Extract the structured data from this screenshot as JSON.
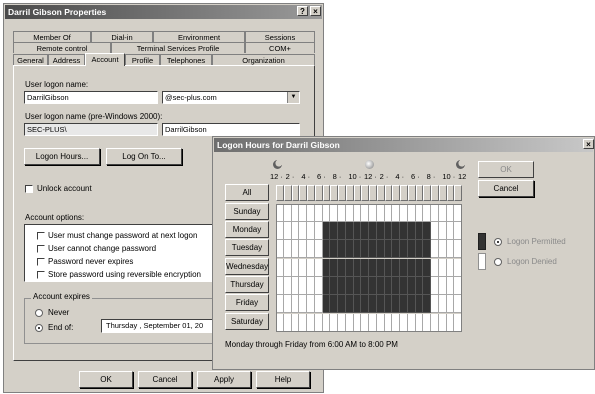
{
  "props": {
    "title": "Darril Gibson Properties",
    "help_btn": "?",
    "close_btn": "×",
    "tabs_row1": [
      "Member Of",
      "Dial-in",
      "Environment",
      "Sessions"
    ],
    "tabs_row2": [
      "Remote control",
      "Terminal Services Profile",
      "COM+"
    ],
    "tabs_row3": [
      "General",
      "Address",
      "Account",
      "Profile",
      "Telephones",
      "Organization"
    ],
    "logon_name_label": "User logon name:",
    "logon_name_value": "DarrilGibson",
    "domain_value": "@sec-plus.com",
    "pre2000_label": "User logon name (pre-Windows 2000):",
    "pre2000_domain": "SEC-PLUS\\",
    "pre2000_name": "DarrilGibson",
    "logon_hours_btn": "Logon Hours...",
    "log_on_to_btn": "Log On To...",
    "unlock_label": "Unlock account",
    "account_options_label": "Account options:",
    "options": [
      "User must change password at next logon",
      "User cannot change password",
      "Password never expires",
      "Store password using reversible encryption"
    ],
    "expires_label": "Account expires",
    "never_label": "Never",
    "endof_label": "End of:",
    "endof_value": "Thursday , September 01, 20",
    "ok_btn": "OK",
    "cancel_btn": "Cancel",
    "apply_btn": "Apply",
    "help_button": "Help"
  },
  "hours": {
    "title": "Logon Hours for Darril Gibson",
    "close_btn": "×",
    "time_labels": [
      "12",
      "2",
      "4",
      "6",
      "8",
      "10",
      "12",
      "2",
      "4",
      "6",
      "8",
      "10",
      "12"
    ],
    "all_label": "All",
    "days": [
      "Sunday",
      "Monday",
      "Tuesday",
      "Wednesday",
      "Thursday",
      "Friday",
      "Saturday"
    ],
    "permitted_days": [
      false,
      true,
      true,
      true,
      true,
      true,
      false
    ],
    "permitted_start_hour": 6,
    "permitted_end_hour": 20,
    "ok_btn": "OK",
    "cancel_btn": "Cancel",
    "permitted_label": "Logon Permitted",
    "denied_label": "Logon Denied",
    "status": "Monday through Friday from 6:00 AM to 8:00 PM",
    "colors": {
      "permitted": "#333333",
      "denied": "#ffffff",
      "grid": "#a8a8a8"
    }
  }
}
